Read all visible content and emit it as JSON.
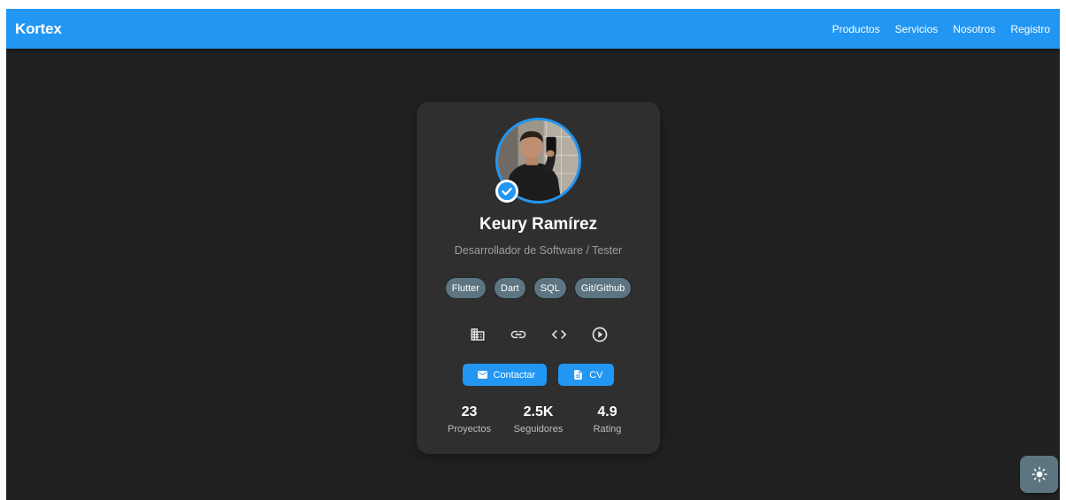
{
  "appbar": {
    "brand": "Kortex",
    "nav": [
      "Productos",
      "Servicios",
      "Nosotros",
      "Registro"
    ]
  },
  "profile": {
    "name": "Keury Ramírez",
    "role": "Desarrollador de Software / Tester",
    "verified": true,
    "skills": [
      "Flutter",
      "Dart",
      "SQL",
      "Git/Github"
    ],
    "links": [
      {
        "icon": "building-icon"
      },
      {
        "icon": "link-icon"
      },
      {
        "icon": "code-icon"
      },
      {
        "icon": "play-circle-icon"
      }
    ],
    "actions": {
      "contact_label": "Contactar",
      "cv_label": "CV"
    },
    "stats": [
      {
        "value": "23",
        "label": "Proyectos"
      },
      {
        "value": "2.5K",
        "label": "Seguidores"
      },
      {
        "value": "4.9",
        "label": "Rating"
      }
    ]
  },
  "theme_toggle": {
    "icon": "sun-icon"
  },
  "colors": {
    "primary": "#2196f3",
    "background": "#212121",
    "card": "#2f2f2f",
    "chip": "#5c7580"
  }
}
